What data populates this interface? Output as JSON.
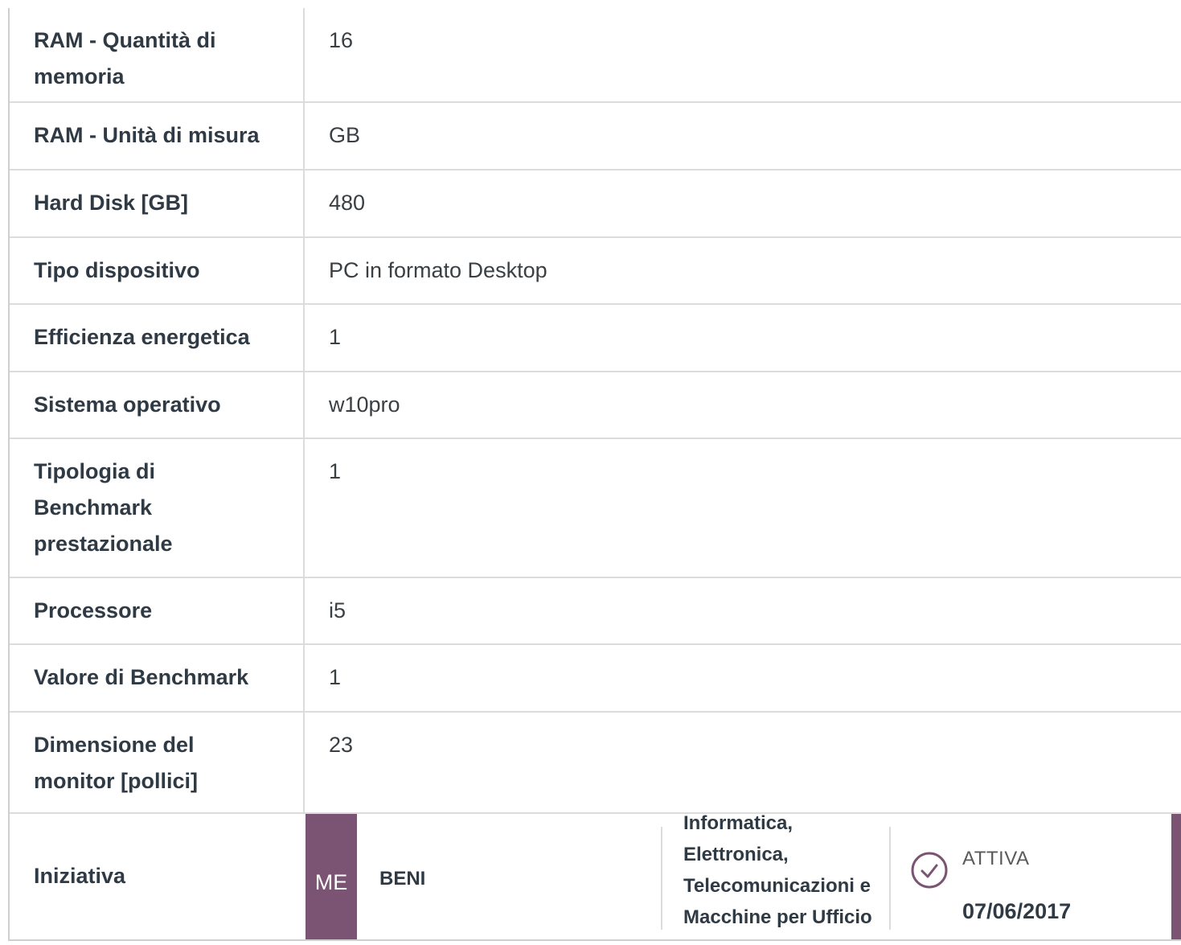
{
  "specs": [
    {
      "label": "RAM - Quantità di memoria",
      "value": "16"
    },
    {
      "label": "RAM - Unità di misura",
      "value": "GB"
    },
    {
      "label": "Hard Disk [GB]",
      "value": "480"
    },
    {
      "label": "Tipo dispositivo",
      "value": "PC in formato Desktop"
    },
    {
      "label": "Efficienza energetica",
      "value": "1"
    },
    {
      "label": "Sistema operativo",
      "value": "w10pro"
    },
    {
      "label": "Tipologia di Benchmark prestazionale",
      "value": "1"
    },
    {
      "label": "Processore",
      "value": "i5"
    },
    {
      "label": "Valore di Benchmark",
      "value": "1"
    },
    {
      "label": "Dimensione del monitor [pollici]",
      "value": "23"
    }
  ],
  "initiative": {
    "label": "Iniziativa",
    "badge": "ME",
    "type": "BENI",
    "category": "Informatica, Elettronica, Telecomunicazioni e Macchine per Ufficio",
    "status": "ATTIVA",
    "date": "07/06/2017",
    "accent_color": "#7a5472"
  }
}
